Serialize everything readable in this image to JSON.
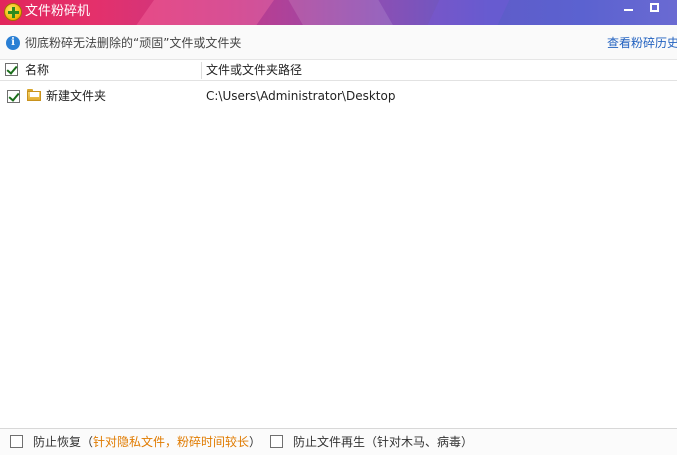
{
  "window": {
    "title": "文件粉碎机"
  },
  "infobar": {
    "message": "彻底粉碎无法删除的“顽固”文件或文件夹",
    "history_link": "查看粉碎历史"
  },
  "table": {
    "columns": [
      "名称",
      "文件或文件夹路径"
    ],
    "rows": [
      {
        "name": "新建文件夹",
        "path": "C:\\Users\\Administrator\\Desktop",
        "checked": true
      }
    ]
  },
  "options": {
    "prevent_recovery": {
      "label": "防止恢复（",
      "note": "针对隐私文件，粉碎时间较长",
      "close": "）",
      "checked": false
    },
    "prevent_regen": {
      "label": "防止文件再生（针对木马、病毒）",
      "checked": false
    }
  },
  "icons": {
    "app": "shredder-app-icon",
    "info": "info-icon",
    "folder": "folder-icon"
  },
  "colors": {
    "link": "#2362c0",
    "note": "#e07b00",
    "info_icon": "#2a7fd4"
  }
}
